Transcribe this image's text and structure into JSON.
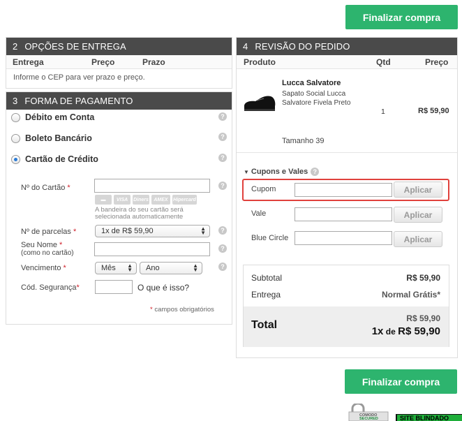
{
  "actions": {
    "checkout_top": "Finalizar compra",
    "checkout_bottom": "Finalizar compra"
  },
  "delivery": {
    "num": "2",
    "title": "OPÇÕES DE ENTREGA",
    "cols": [
      "Entrega",
      "Preço",
      "Prazo"
    ],
    "hint": "Informe o CEP para ver prazo e preço."
  },
  "payment": {
    "num": "3",
    "title": "FORMA DE PAGAMENTO",
    "methods": [
      "Débito em Conta",
      "Boleto Bancário",
      "Cartão de Crédito"
    ],
    "selected_method": "Cartão de Crédito",
    "card_number_label": "Nº do Cartão",
    "card_logos": [
      "VISA",
      "Diners",
      "AMEX",
      "Hipercard"
    ],
    "brand_note_1": "A bandeira do seu cartão será",
    "brand_note_2": "selecionada automaticamente",
    "installments_label": "Nº de parcelas",
    "installments_value": "1x de R$ 59,90",
    "name_label": "Seu Nome",
    "name_sublabel": "(como no cartão)",
    "expiry_label": "Vencimento",
    "month_value": "Mês",
    "year_value": "Ano",
    "cvv_label": "Cód. Segurança",
    "cvv_help": "O que é isso?",
    "required_star": "*",
    "required_note": "campos obrigatórios"
  },
  "review": {
    "num": "4",
    "title": "REVISÃO DO PEDIDO",
    "cols": [
      "Produto",
      "Qtd",
      "Preço"
    ],
    "product": {
      "name": "Lucca Salvatore",
      "desc_1": "Sapato Social Lucca",
      "desc_2": "Salvatore Fivela Preto",
      "qty": "1",
      "price": "R$ 59,90",
      "size": "Tamanho 39"
    },
    "coupons_title": "Cupons e Vales",
    "fields": [
      {
        "label": "Cupom",
        "button": "Aplicar"
      },
      {
        "label": "Vale",
        "button": "Aplicar"
      },
      {
        "label": "Blue Circle",
        "button": "Aplicar"
      }
    ],
    "subtotal_label": "Subtotal",
    "subtotal_value": "R$ 59,90",
    "shipping_label": "Entrega",
    "shipping_value": "Normal Grátis*",
    "total_label": "Total",
    "total_value": "R$ 59,90",
    "installment_prefix": "1x",
    "installment_de": "de",
    "installment_value": "R$ 59,90"
  },
  "seals": {
    "comodo_1": "COMODO",
    "comodo_2": "SECURED",
    "blindado": "SITE BLINDADO"
  },
  "colors": {
    "green": "#2db46e",
    "panel_header": "#4a4a4a",
    "highlight": "#e0413c"
  }
}
